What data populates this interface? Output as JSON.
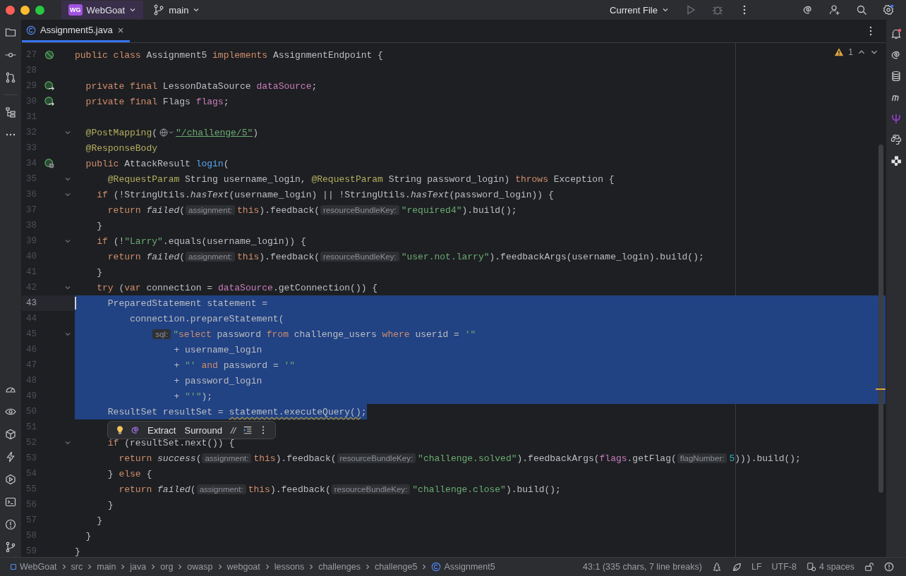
{
  "title_bar": {
    "project_badge": "WG",
    "project": "WebGoat",
    "branch": "main",
    "run_config": "Current File"
  },
  "tabs": [
    {
      "label": "Assignment5.java",
      "selected": true
    }
  ],
  "editor": {
    "warnings": "1",
    "lines": [
      {
        "number": "27",
        "kind": "bean",
        "foldable": false,
        "current": false,
        "selected": false,
        "tokens": [
          {
            "kind": "kw",
            "text": "public class "
          },
          {
            "kind": "id",
            "text": "Assignment5 "
          },
          {
            "kind": "kw",
            "text": "implements "
          },
          {
            "kind": "id",
            "text": "AssignmentEndpoint {"
          }
        ]
      },
      {
        "number": "28",
        "kind": "plain",
        "foldable": false,
        "current": false,
        "selected": false
      },
      {
        "number": "29",
        "kind": "injection",
        "foldable": false,
        "current": false,
        "selected": false,
        "tokens": [
          {
            "kind": "kw",
            "text": "  private final "
          },
          {
            "kind": "id",
            "text": "LessonDataSource "
          },
          {
            "kind": "field",
            "text": "dataSource"
          },
          {
            "kind": "id",
            "text": ";"
          }
        ]
      },
      {
        "number": "30",
        "kind": "injection",
        "foldable": false,
        "current": false,
        "selected": false,
        "tokens": [
          {
            "kind": "kw",
            "text": "  private final "
          },
          {
            "kind": "id",
            "text": "Flags "
          },
          {
            "kind": "field",
            "text": "flags"
          },
          {
            "kind": "id",
            "text": ";"
          }
        ]
      },
      {
        "number": "31",
        "kind": "plain",
        "foldable": false,
        "current": false,
        "selected": false
      },
      {
        "number": "32",
        "kind": "plain",
        "foldable": true,
        "current": false,
        "selected": false,
        "tokens": [
          {
            "kind": "ann",
            "text": "  @PostMapping"
          },
          {
            "kind": "id",
            "text": "("
          },
          {
            "kind": "endpoint"
          },
          {
            "kind": "link",
            "text": "\"/challenge/5\""
          },
          {
            "kind": "id",
            "text": ")"
          }
        ]
      },
      {
        "number": "33",
        "kind": "plain",
        "foldable": false,
        "current": false,
        "selected": false,
        "tokens": [
          {
            "kind": "ann",
            "text": "  @ResponseBody"
          }
        ]
      },
      {
        "number": "34",
        "kind": "endpoint",
        "foldable": false,
        "current": false,
        "selected": false,
        "tokens": [
          {
            "kind": "kw",
            "text": "  public "
          },
          {
            "kind": "id",
            "text": "AttackResult "
          },
          {
            "kind": "decl",
            "text": "login"
          },
          {
            "kind": "id",
            "text": "("
          }
        ]
      },
      {
        "number": "35",
        "kind": "plain",
        "foldable": true,
        "current": false,
        "selected": false,
        "tokens": [
          {
            "kind": "ann",
            "text": "      @RequestParam "
          },
          {
            "kind": "id",
            "text": "String username_login, "
          },
          {
            "kind": "ann",
            "text": "@RequestParam "
          },
          {
            "kind": "id",
            "text": "String password_login) "
          },
          {
            "kind": "kw",
            "text": "throws "
          },
          {
            "kind": "id",
            "text": "Exception {"
          }
        ]
      },
      {
        "number": "36",
        "kind": "plain",
        "foldable": true,
        "current": false,
        "selected": false,
        "tokens": [
          {
            "kind": "kw",
            "text": "    if "
          },
          {
            "kind": "id",
            "text": "(!StringUtils."
          },
          {
            "kind": "call",
            "text": "hasText"
          },
          {
            "kind": "id",
            "text": "(username_login) || !StringUtils."
          },
          {
            "kind": "call",
            "text": "hasText"
          },
          {
            "kind": "id",
            "text": "(password_login)) {"
          }
        ]
      },
      {
        "number": "37",
        "kind": "plain",
        "foldable": false,
        "current": false,
        "selected": false,
        "tokens": [
          {
            "kind": "kw",
            "text": "      return "
          },
          {
            "kind": "call",
            "text": "failed"
          },
          {
            "kind": "id",
            "text": "("
          },
          {
            "kind": "hint",
            "text": "assignment:"
          },
          {
            "kind": "kw",
            "text": "this"
          },
          {
            "kind": "id",
            "text": ").feedback("
          },
          {
            "kind": "hint",
            "text": "resourceBundleKey:"
          },
          {
            "kind": "str",
            "text": "\"required4\""
          },
          {
            "kind": "id",
            "text": ").build();"
          }
        ]
      },
      {
        "number": "38",
        "kind": "plain",
        "foldable": false,
        "current": false,
        "selected": false,
        "tokens": [
          {
            "kind": "id",
            "text": "    }"
          }
        ]
      },
      {
        "number": "39",
        "kind": "plain",
        "foldable": true,
        "current": false,
        "selected": false,
        "tokens": [
          {
            "kind": "kw",
            "text": "    if "
          },
          {
            "kind": "id",
            "text": "(!"
          },
          {
            "kind": "str",
            "text": "\"Larry\""
          },
          {
            "kind": "id",
            "text": ".equals(username_login)) {"
          }
        ]
      },
      {
        "number": "40",
        "kind": "plain",
        "foldable": false,
        "current": false,
        "selected": false,
        "tokens": [
          {
            "kind": "kw",
            "text": "      return "
          },
          {
            "kind": "call",
            "text": "failed"
          },
          {
            "kind": "id",
            "text": "("
          },
          {
            "kind": "hint",
            "text": "assignment:"
          },
          {
            "kind": "kw",
            "text": "this"
          },
          {
            "kind": "id",
            "text": ").feedback("
          },
          {
            "kind": "hint",
            "text": "resourceBundleKey:"
          },
          {
            "kind": "str",
            "text": "\"user.not.larry\""
          },
          {
            "kind": "id",
            "text": ").feedbackArgs(username_login).build();"
          }
        ]
      },
      {
        "number": "41",
        "kind": "plain",
        "foldable": false,
        "current": false,
        "selected": false,
        "tokens": [
          {
            "kind": "id",
            "text": "    }"
          }
        ]
      },
      {
        "number": "42",
        "kind": "plain",
        "foldable": true,
        "current": false,
        "selected": false,
        "tokens": [
          {
            "kind": "kw",
            "text": "    try "
          },
          {
            "kind": "id",
            "text": "("
          },
          {
            "kind": "kw",
            "text": "var "
          },
          {
            "kind": "id",
            "text": "connection = "
          },
          {
            "kind": "field",
            "text": "dataSource"
          },
          {
            "kind": "id",
            "text": ".getConnection()) {"
          }
        ]
      },
      {
        "number": "43",
        "kind": "plain",
        "foldable": false,
        "current": true,
        "selected": true,
        "tokens": [
          {
            "kind": "id",
            "text": "      PreparedStatement statement ="
          }
        ]
      },
      {
        "number": "44",
        "kind": "plain",
        "foldable": false,
        "current": false,
        "selected": true,
        "tokens": [
          {
            "kind": "id",
            "text": "          connection.prepareStatement("
          }
        ]
      },
      {
        "number": "45",
        "kind": "plain",
        "foldable": true,
        "current": false,
        "selected": true,
        "tokens": [
          {
            "kind": "hint",
            "text": "              sql:"
          },
          {
            "kind": "str",
            "text": "\""
          },
          {
            "kind": "kw",
            "text": "select "
          },
          {
            "kind": "id",
            "text": "password "
          },
          {
            "kind": "kw",
            "text": "from "
          },
          {
            "kind": "id",
            "text": "challenge_users "
          },
          {
            "kind": "kw",
            "text": "where "
          },
          {
            "kind": "id",
            "text": "userid = "
          },
          {
            "kind": "str",
            "text": "'\""
          }
        ]
      },
      {
        "number": "46",
        "kind": "plain",
        "foldable": false,
        "current": false,
        "selected": true,
        "tokens": [
          {
            "kind": "id",
            "text": "                  + username_login"
          }
        ]
      },
      {
        "number": "47",
        "kind": "plain",
        "foldable": false,
        "current": false,
        "selected": true,
        "tokens": [
          {
            "kind": "id",
            "text": "                  + "
          },
          {
            "kind": "str",
            "text": "\"' "
          },
          {
            "kind": "kw",
            "text": "and "
          },
          {
            "kind": "id",
            "text": "password = "
          },
          {
            "kind": "str",
            "text": "'\""
          }
        ]
      },
      {
        "number": "48",
        "kind": "plain",
        "foldable": false,
        "current": false,
        "selected": true,
        "tokens": [
          {
            "kind": "id",
            "text": "                  + password_login"
          }
        ]
      },
      {
        "number": "49",
        "kind": "plain",
        "foldable": false,
        "current": false,
        "selected": true,
        "tokens": [
          {
            "kind": "id",
            "text": "                  + "
          },
          {
            "kind": "str",
            "text": "\"'\""
          },
          {
            "kind": "id",
            "text": ");"
          }
        ]
      },
      {
        "number": "50",
        "kind": "plain",
        "foldable": false,
        "current": false,
        "selected": true,
        "selection_partial": true,
        "tokens": [
          {
            "kind": "id",
            "text": "      ResultSet resultSet = "
          },
          {
            "kind": "warn",
            "text": "statement.executeQuery()"
          },
          {
            "kind": "id",
            "text": ";"
          }
        ]
      },
      {
        "number": "51",
        "kind": "plain",
        "foldable": false,
        "current": false,
        "selected": false,
        "popup": {
          "actions": [
            "Extract",
            "Surround"
          ],
          "comment": "//"
        }
      },
      {
        "number": "52",
        "kind": "plain",
        "foldable": true,
        "current": false,
        "selected": false,
        "tokens": [
          {
            "kind": "kw",
            "text": "      if "
          },
          {
            "kind": "id",
            "text": "(resultSet.next()) {"
          }
        ]
      },
      {
        "number": "53",
        "kind": "plain",
        "foldable": false,
        "current": false,
        "selected": false,
        "tokens": [
          {
            "kind": "kw",
            "text": "        return "
          },
          {
            "kind": "call",
            "text": "success"
          },
          {
            "kind": "id",
            "text": "("
          },
          {
            "kind": "hint",
            "text": "assignment:"
          },
          {
            "kind": "kw",
            "text": "this"
          },
          {
            "kind": "id",
            "text": ").feedback("
          },
          {
            "kind": "hint",
            "text": "resourceBundleKey:"
          },
          {
            "kind": "str",
            "text": "\"challenge.solved\""
          },
          {
            "kind": "id",
            "text": ").feedbackArgs("
          },
          {
            "kind": "field",
            "text": "flags"
          },
          {
            "kind": "id",
            "text": ".getFlag("
          },
          {
            "kind": "hint",
            "text": "flagNumber:"
          },
          {
            "kind": "num",
            "text": "5"
          },
          {
            "kind": "id",
            "text": "))).build();"
          }
        ]
      },
      {
        "number": "54",
        "kind": "plain",
        "foldable": false,
        "current": false,
        "selected": false,
        "tokens": [
          {
            "kind": "id",
            "text": "      } "
          },
          {
            "kind": "kw",
            "text": "else "
          },
          {
            "kind": "id",
            "text": "{"
          }
        ]
      },
      {
        "number": "55",
        "kind": "plain",
        "foldable": false,
        "current": false,
        "selected": false,
        "tokens": [
          {
            "kind": "kw",
            "text": "        return "
          },
          {
            "kind": "call",
            "text": "failed"
          },
          {
            "kind": "id",
            "text": "("
          },
          {
            "kind": "hint",
            "text": "assignment:"
          },
          {
            "kind": "kw",
            "text": "this"
          },
          {
            "kind": "id",
            "text": ").feedback("
          },
          {
            "kind": "hint",
            "text": "resourceBundleKey:"
          },
          {
            "kind": "str",
            "text": "\"challenge.close\""
          },
          {
            "kind": "id",
            "text": ").build();"
          }
        ]
      },
      {
        "number": "56",
        "kind": "plain",
        "foldable": false,
        "current": false,
        "selected": false,
        "tokens": [
          {
            "kind": "id",
            "text": "      }"
          }
        ]
      },
      {
        "number": "57",
        "kind": "plain",
        "foldable": false,
        "current": false,
        "selected": false,
        "tokens": [
          {
            "kind": "id",
            "text": "    }"
          }
        ]
      },
      {
        "number": "58",
        "kind": "plain",
        "foldable": false,
        "current": false,
        "selected": false,
        "tokens": [
          {
            "kind": "id",
            "text": "  }"
          }
        ]
      },
      {
        "number": "59",
        "kind": "plain",
        "foldable": false,
        "current": false,
        "selected": false,
        "tokens": [
          {
            "kind": "id",
            "text": "}"
          }
        ]
      }
    ]
  },
  "status_bar": {
    "breadcrumbs": [
      "WebGoat",
      "src",
      "main",
      "java",
      "org",
      "owasp",
      "webgoat",
      "lessons",
      "challenges",
      "challenge5",
      "Assignment5"
    ],
    "position": "43:1 (335 chars, 7 line breaks)",
    "line_ending": "LF",
    "encoding": "UTF-8",
    "indent": "4 spaces"
  }
}
